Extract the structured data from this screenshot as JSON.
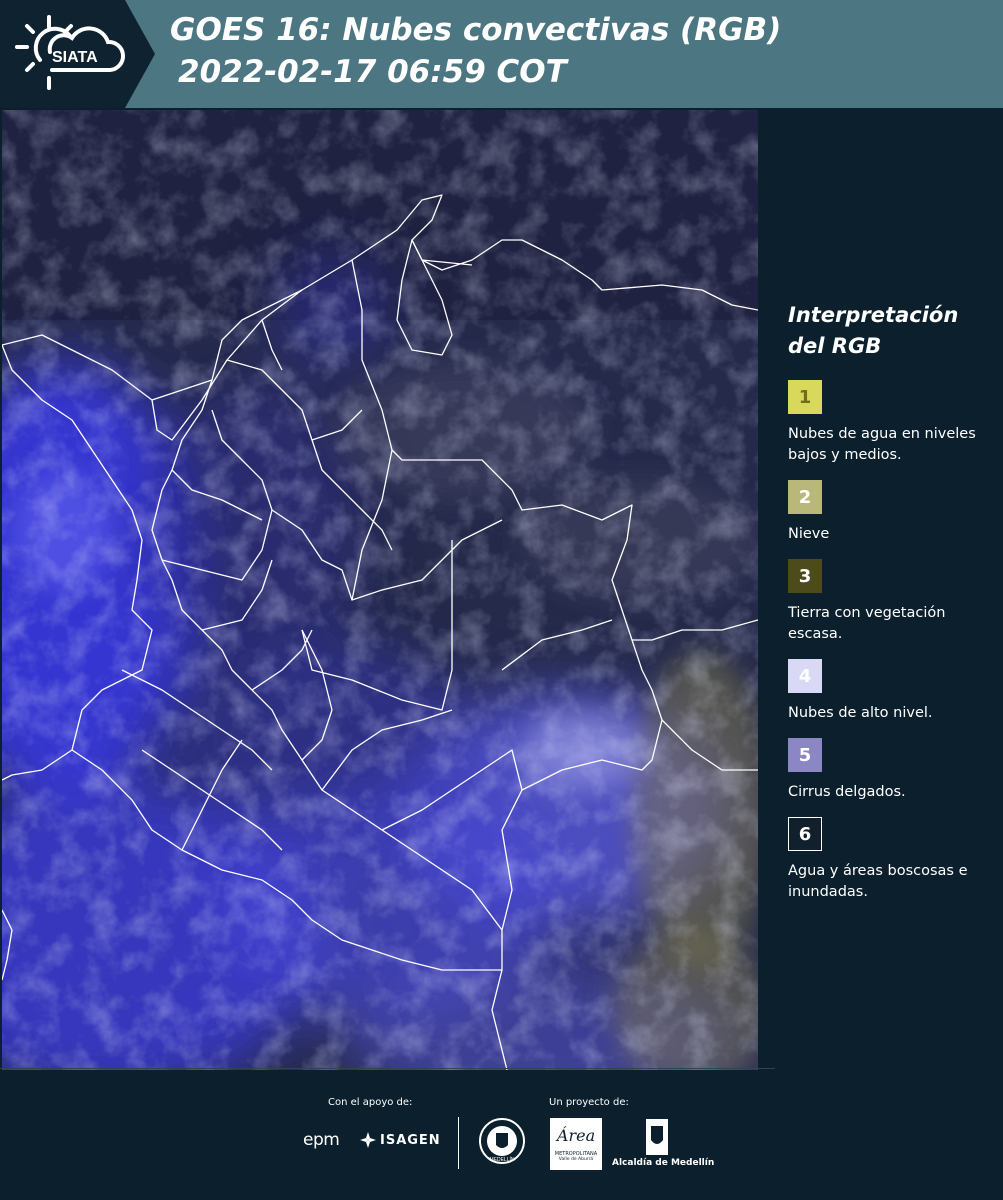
{
  "header": {
    "brand": "SIATA",
    "title_line1": "GOES 16: Nubes convectivas (RGB)",
    "title_line2": "2022-02-17 06:59 COT"
  },
  "legend": {
    "title": "Interpretación\ndel RGB",
    "items": [
      {
        "number": "1",
        "label": "Nubes de agua en niveles bajos y medios.",
        "color": "#d8d85a",
        "text_color": "#6e6e1e"
      },
      {
        "number": "2",
        "label": "Nieve",
        "color": "#b9b77a",
        "text_color": "#ffffff"
      },
      {
        "number": "3",
        "label": "Tierra con vegetación escasa.",
        "color": "#4d4b1c",
        "text_color": "#ffffff"
      },
      {
        "number": "4",
        "label": "Nubes de alto nivel.",
        "color": "#d9d8f5",
        "text_color": "#ffffff"
      },
      {
        "number": "5",
        "label": "Cirrus delgados.",
        "color": "#8a87c4",
        "text_color": "#ffffff"
      },
      {
        "number": "6",
        "label": "Agua y áreas boscosas e inundadas.",
        "color": "#10202d",
        "text_color": "#ffffff"
      }
    ]
  },
  "footer": {
    "support_label": "Con el apoyo de:",
    "project_label": "Un proyecto de:",
    "sponsor_epm": "epm",
    "sponsor_isagen": "ISAGEN",
    "metro_name": "Área",
    "metro_sub1": "METROPOLITANA",
    "metro_sub2": "Valle de Aburrá",
    "alcaldia": "Alcaldía de Medellín",
    "medellin_seal": "MEDELLÍN"
  },
  "map": {
    "colors": {
      "deep_cloud": "#3a3ae8",
      "clear": "#24294a",
      "border": "#ffffff"
    }
  }
}
